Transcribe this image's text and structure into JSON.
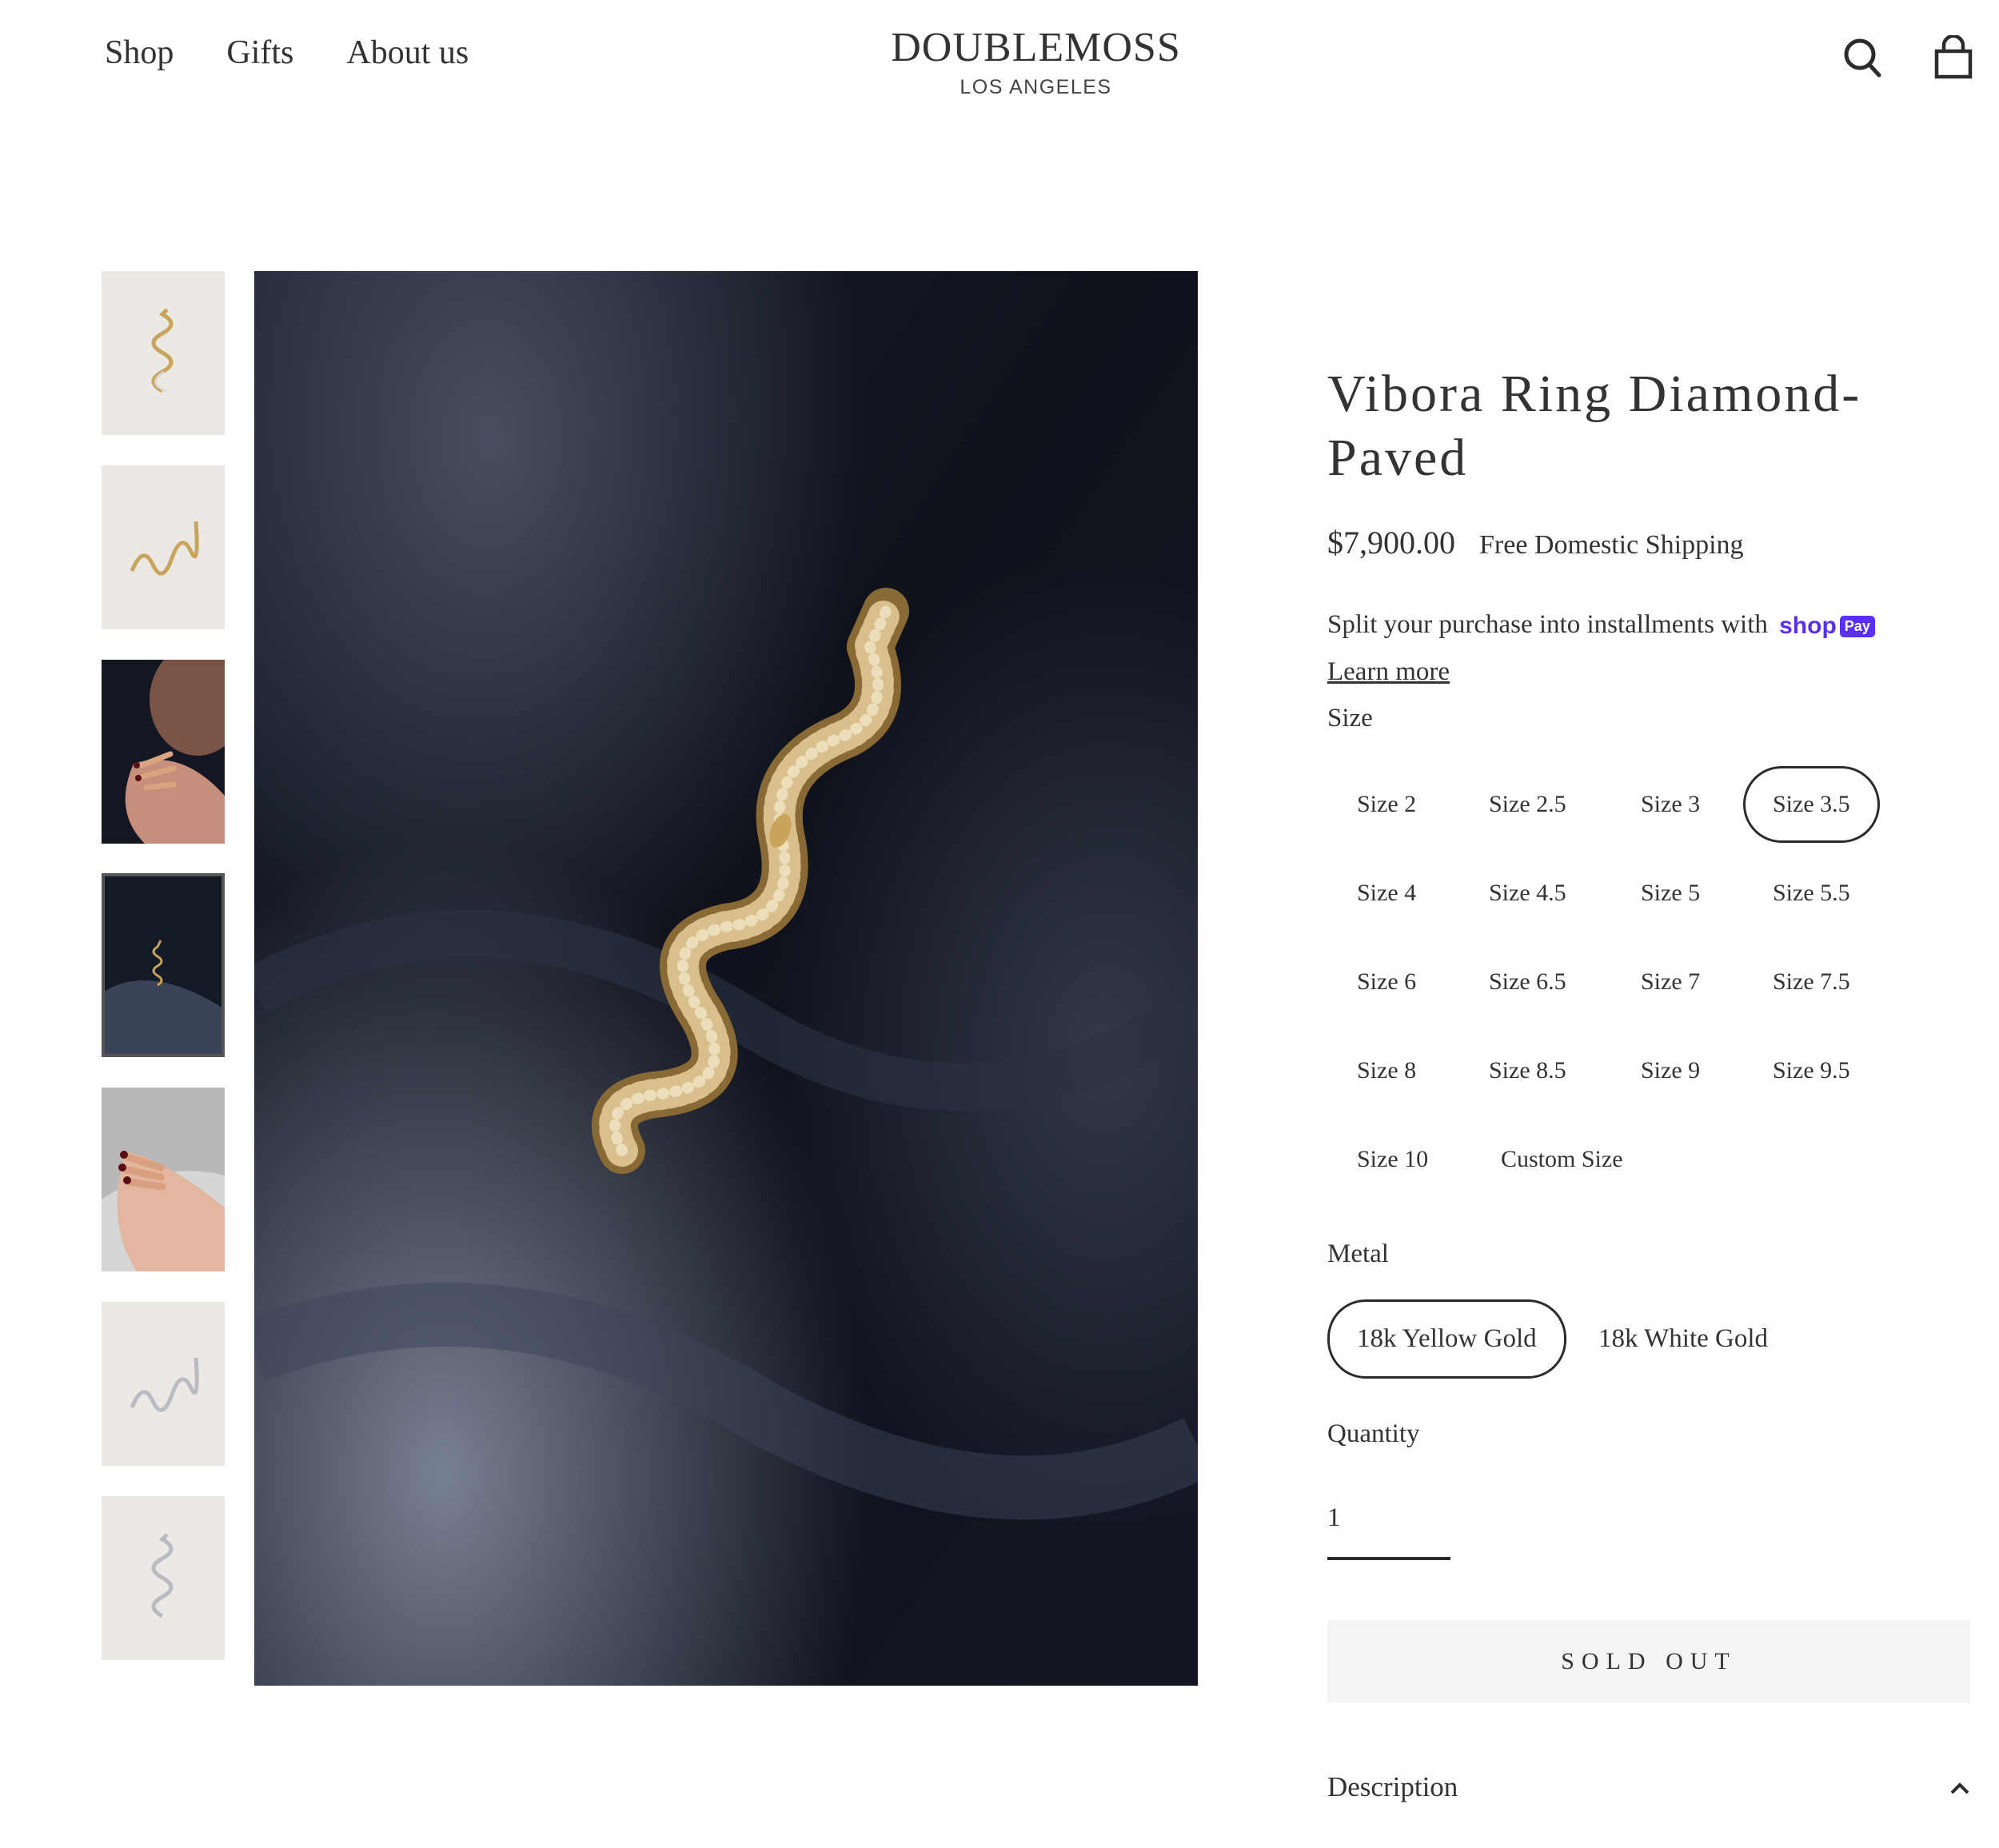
{
  "header": {
    "nav": [
      "Shop",
      "Gifts",
      "About us"
    ],
    "brand": "DOUBLEMOSS",
    "city": "LOS ANGELES",
    "icons": [
      "search-icon",
      "cart-icon"
    ]
  },
  "gallery": {
    "thumbnail_count": 7,
    "selected_thumbnail": 4,
    "hero_image": "gold diamond-paved snake ring on dark navy silk"
  },
  "product": {
    "title": "Vibora Ring Diamond-Paved",
    "price": "$7,900.00",
    "shipping": "Free Domestic Shipping",
    "installments_text": "Split your purchase into installments with",
    "shop_pay": {
      "shop": "shop",
      "pay": "Pay"
    },
    "learn_more": "Learn more",
    "size_label": "Size",
    "sizes": [
      "Size 2",
      "Size 2.5",
      "Size 3",
      "Size 3.5",
      "Size 4",
      "Size 4.5",
      "Size 5",
      "Size 5.5",
      "Size 6",
      "Size 6.5",
      "Size 7",
      "Size 7.5",
      "Size 8",
      "Size 8.5",
      "Size 9",
      "Size 9.5",
      "Size 10",
      "Custom Size"
    ],
    "selected_size": "Size 3.5",
    "metal_label": "Metal",
    "metals": [
      "18k Yellow Gold",
      "18k White Gold"
    ],
    "selected_metal": "18k Yellow Gold",
    "quantity_label": "Quantity",
    "quantity": "1",
    "button_label": "SOLD OUT",
    "description_label": "Description"
  },
  "colors": {
    "text": "#2b2b2b",
    "shop_pay": "#5a31f4",
    "button_bg": "#f4f4f4",
    "thumb_bg": "#ece9e4"
  }
}
